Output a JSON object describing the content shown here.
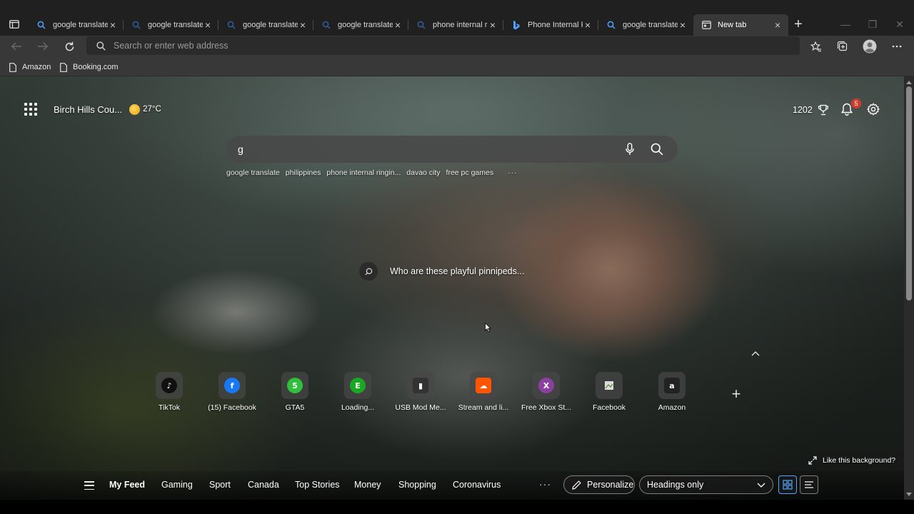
{
  "browser": {
    "tabs": [
      {
        "title": "google translate",
        "icon": "search-icon",
        "active": false
      },
      {
        "title": "google translate",
        "icon": "search-icon",
        "active": false
      },
      {
        "title": "google translate",
        "icon": "search-icon",
        "active": false
      },
      {
        "title": "google translate",
        "icon": "search-icon",
        "active": false
      },
      {
        "title": "phone internal ri",
        "icon": "search-icon",
        "active": false
      },
      {
        "title": "Phone Internal Ri",
        "icon": "bing-icon",
        "active": false
      },
      {
        "title": "google translate",
        "icon": "search-icon",
        "active": false
      },
      {
        "title": "New tab",
        "icon": "new-tab-page-icon",
        "active": true
      }
    ],
    "address_placeholder": "Search or enter web address",
    "favorites": [
      {
        "label": "Amazon",
        "icon": "page-icon"
      },
      {
        "label": "Booking.com",
        "icon": "page-icon"
      }
    ]
  },
  "newtab": {
    "location": "Birch Hills Cou...",
    "temperature": "27",
    "temp_unit": "°C",
    "rewards_points": "1202",
    "notification_count": "5",
    "search_value": "g",
    "suggestions": [
      "google translate",
      "philippines",
      "phone internal ringin...",
      "davao city",
      "free pc games"
    ],
    "suggestions_more": "···",
    "image_caption": "Who are these playful pinnipeds...",
    "quick_links": [
      {
        "label": "TikTok",
        "icon": "tiktok-icon",
        "color": "#111111"
      },
      {
        "label": "(15) Facebook",
        "icon": "facebook-icon",
        "color": "#1877f2"
      },
      {
        "label": "GTA5",
        "icon": "gta5-icon",
        "color": "#2fbf3a"
      },
      {
        "label": "Loading...",
        "icon": "e-icon",
        "color": "#1aa822"
      },
      {
        "label": "USB Mod Me...",
        "icon": "usb-icon",
        "color": "#333333"
      },
      {
        "label": "Stream and li...",
        "icon": "soundcloud-icon",
        "color": "#ff5500"
      },
      {
        "label": "Free Xbox St...",
        "icon": "x-icon",
        "color": "#8b3f9e"
      },
      {
        "label": "Facebook",
        "icon": "broken-image-icon",
        "color": "#555555"
      },
      {
        "label": "Amazon",
        "icon": "amazon-icon",
        "color": "#222222"
      }
    ],
    "like_background": "Like this background?",
    "feed": {
      "tabs": [
        "My Feed",
        "Gaming",
        "Sport",
        "Canada",
        "Top Stories",
        "Money",
        "Shopping",
        "Coronavirus"
      ],
      "more": "···",
      "personalize": "Personalize",
      "layout_value": "Headings only"
    }
  },
  "colors": {
    "tabstrip": "#202020",
    "toolbar": "#383838",
    "accent": "#5aa6ff",
    "badge": "#d13b2b"
  }
}
